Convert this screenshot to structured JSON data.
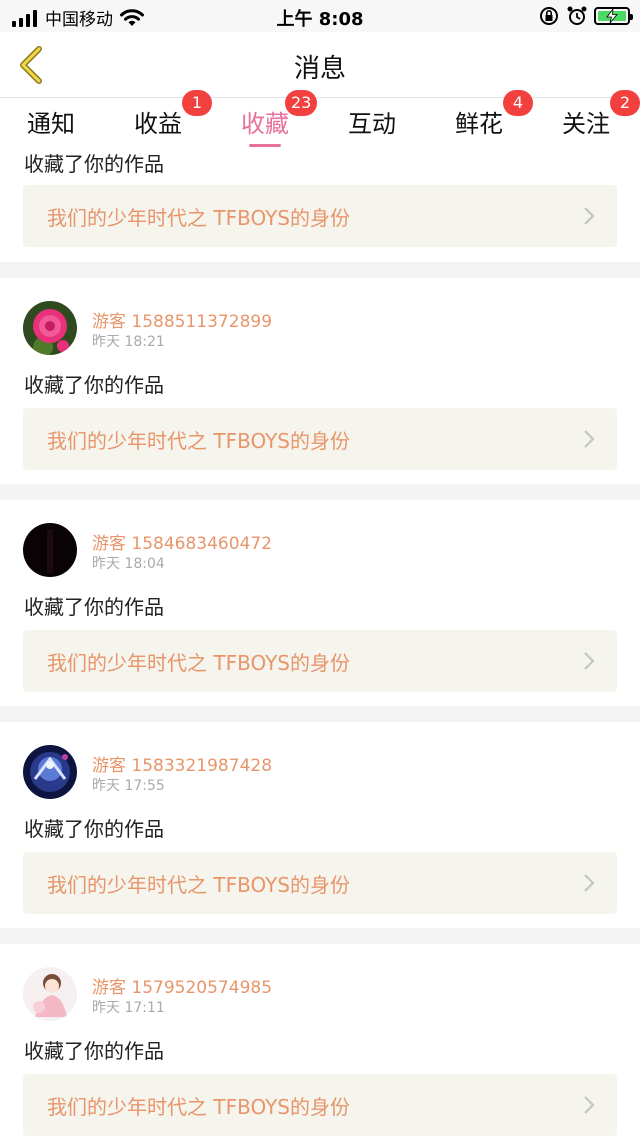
{
  "status_bar": {
    "carrier": "中国移动",
    "time": "上午 8:08",
    "icons": [
      "signal-icon",
      "wifi-icon",
      "orientation-lock-icon",
      "alarm-icon",
      "battery-charging-icon"
    ]
  },
  "header": {
    "title": "消息",
    "back_icon": "chevron-left-icon"
  },
  "tabs": [
    {
      "label": "通知",
      "badge": ""
    },
    {
      "label": "收益",
      "badge": "1"
    },
    {
      "label": "收藏",
      "badge": "23",
      "active": true
    },
    {
      "label": "互动",
      "badge": ""
    },
    {
      "label": "鲜花",
      "badge": "4"
    },
    {
      "label": "关注",
      "badge": "2"
    }
  ],
  "colors": {
    "accent": "#e8709c",
    "badge": "#f2403f",
    "username": "#e8956a",
    "card_bg": "#f5f5ee"
  },
  "messages": [
    {
      "user": "",
      "time": "",
      "action": "收藏了你的作品",
      "work": "我们的少年时代之 TFBOYS的身份",
      "avatar": ""
    },
    {
      "user": "游客 1588511372899",
      "time": "昨天 18:21",
      "action": "收藏了你的作品",
      "work": "我们的少年时代之 TFBOYS的身份",
      "avatar": "rose"
    },
    {
      "user": "游客 1584683460472",
      "time": "昨天 18:04",
      "action": "收藏了你的作品",
      "work": "我们的少年时代之 TFBOYS的身份",
      "avatar": "dark"
    },
    {
      "user": "游客 1583321987428",
      "time": "昨天 17:55",
      "action": "收藏了你的作品",
      "work": "我们的少年时代之 TFBOYS的身份",
      "avatar": "night"
    },
    {
      "user": "游客 1579520574985",
      "time": "昨天 17:11",
      "action": "收藏了你的作品",
      "work": "我们的少年时代之 TFBOYS的身份",
      "avatar": "anime"
    }
  ]
}
